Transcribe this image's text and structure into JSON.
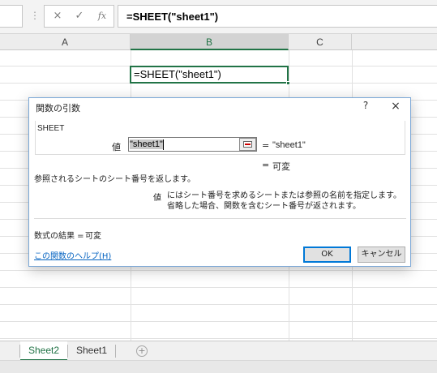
{
  "formula_bar": {
    "dots": "⋮",
    "cancel_icon": "×",
    "enter_icon": "✓",
    "fx_label": "fx",
    "formula": "=SHEET(\"sheet1\")"
  },
  "columns": [
    "A",
    "B",
    "C"
  ],
  "active_cell": {
    "value": "=SHEET(\"sheet1\")"
  },
  "dialog": {
    "title": "関数の引数",
    "help_glyph": "?",
    "close_glyph": "×",
    "function_name": "SHEET",
    "arg_label": "値",
    "arg_input_value": "\"sheet1\"",
    "arg_eq": "=",
    "arg_result": "\"sheet1\"",
    "result_eq": "=",
    "result_value": "可変",
    "description": "参照されるシートのシート番号を返します。",
    "arg_desc_name": "値",
    "arg_desc": "にはシート番号を求めるシートまたは参照の名前を指定します。省略した場合、関数を含むシート番号が返されます。",
    "formula_result_label": "数式の結果 =",
    "formula_result_value": "可変",
    "help_link": "この関数のヘルプ(H)",
    "ok_label": "OK",
    "cancel_label": "キャンセル"
  },
  "sheet_tabs": [
    {
      "label": "Sheet2",
      "active": true
    },
    {
      "label": "Sheet1",
      "active": false
    }
  ],
  "add_sheet_glyph": "+",
  "colors": {
    "accent_green": "#217346",
    "link_blue": "#0563c1",
    "ok_border": "#0078d7"
  }
}
